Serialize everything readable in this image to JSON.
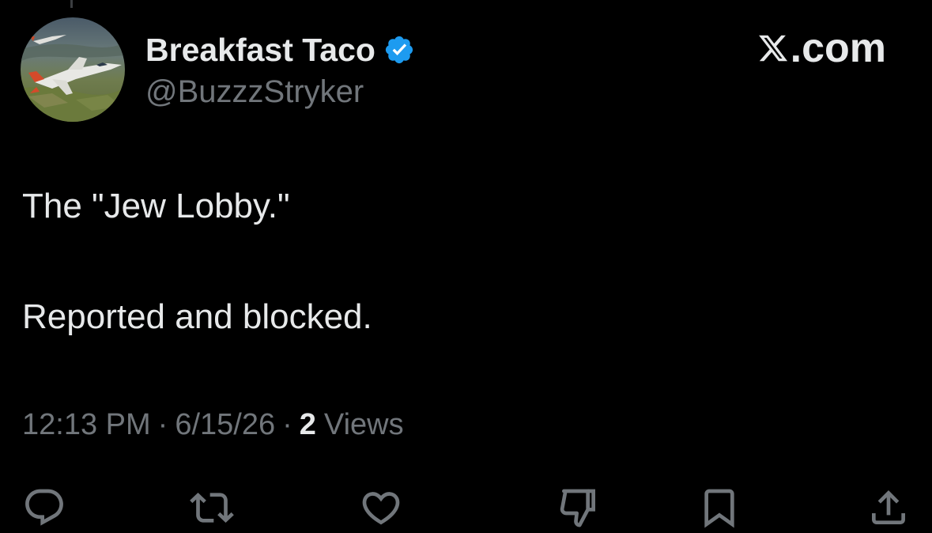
{
  "author": {
    "display_name": "Breakfast Taco",
    "handle": "@BuzzzStryker",
    "verified": true,
    "avatar_icon": "fighter-jet-photo-avatar"
  },
  "brand": {
    "text": ".com",
    "icon": "x-logo-icon"
  },
  "tweet": {
    "line_1": "The \"Jew Lobby.\"",
    "line_2": "Reported and blocked."
  },
  "meta": {
    "time": "12:13 PM",
    "separator": "·",
    "date": "6/15/26",
    "views_count": "2",
    "views_label": "Views"
  },
  "actions": [
    "reply-icon",
    "repost-icon",
    "like-icon",
    "downvote-icon",
    "bookmark-icon",
    "share-icon"
  ],
  "colors": {
    "background": "#000000",
    "primary_text": "#e7e9ea",
    "secondary_text": "#71767b",
    "verified_blue": "#1d9bf0"
  }
}
